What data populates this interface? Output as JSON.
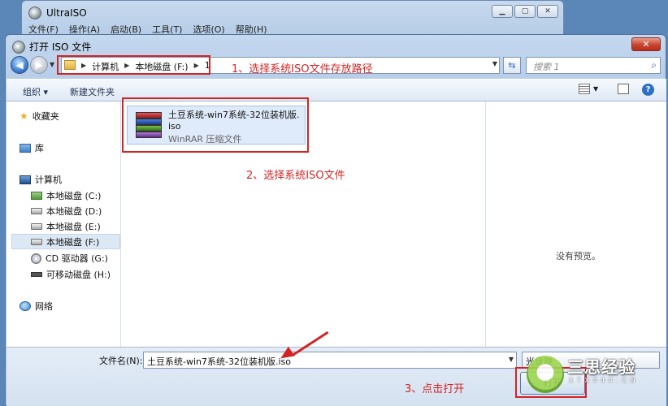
{
  "main_window": {
    "title": "UltraISO",
    "menu": [
      "文件(F)",
      "操作(A)",
      "启动(B)",
      "工具(T)",
      "选项(O)",
      "帮助(H)"
    ]
  },
  "dialog": {
    "title": "打开 ISO 文件",
    "close_label": "✕",
    "address": {
      "crumbs": [
        "计算机",
        "本地磁盘 (F:)",
        "1"
      ]
    },
    "search_placeholder": "搜索 1",
    "toolbar": {
      "organize_label": "组织 ▾",
      "new_folder_label": "新建文件夹"
    },
    "sidebar": {
      "favorites": "收藏夹",
      "libraries": "库",
      "computer": "计算机",
      "drives": [
        "本地磁盘 (C:)",
        "本地磁盘 (D:)",
        "本地磁盘 (E:)",
        "本地磁盘 (F:)",
        "CD 驱动器 (G:)",
        "可移动磁盘 (H:)"
      ],
      "network": "网络"
    },
    "file": {
      "name_line1": "土豆系统-win7系统-32位装机版.",
      "name_line2": "iso",
      "type": "WinRAR 压缩文件"
    },
    "preview_text": "没有预览。",
    "filename_label": "文件名(N):",
    "filename_value": "土豆系统-win7系统-32位装机版.iso",
    "filter_value": "光盘映",
    "open_label": "打开"
  },
  "annotations": {
    "step1": "1、选择系统ISO文件存放路径",
    "step2": "2、选择系统ISO文件",
    "step3": "3、点击打开"
  },
  "watermark": {
    "text": "三思经验",
    "sub": "X T X 4 4 4 . C N"
  },
  "colors": {
    "annotation_red": "#d32424",
    "title_bar": "#c4d8ef",
    "selection": "#dfeafa"
  }
}
